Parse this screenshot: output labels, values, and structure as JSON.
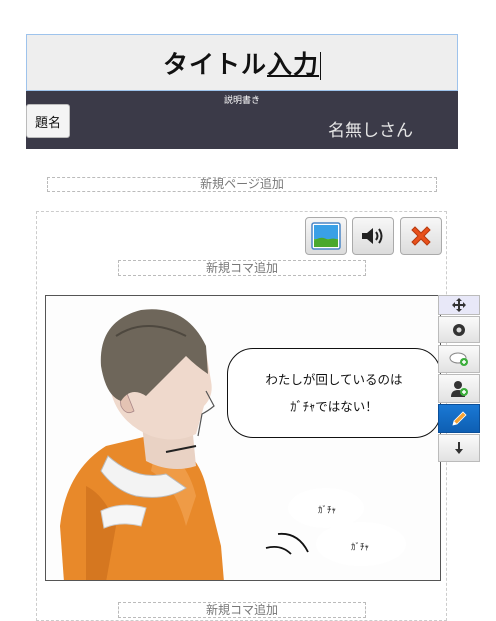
{
  "title": {
    "text_plain": "タイトル",
    "text_composing": "入力"
  },
  "header": {
    "description_label": "説明書き",
    "subject_button": "題名",
    "author_name": "名無しさん"
  },
  "add_page_label": "新規ページ追加",
  "add_panel_label": "新規コマ追加",
  "page_toolbar": {
    "image_icon": "image-icon",
    "sound_icon": "speaker-icon",
    "delete_icon": "close-icon"
  },
  "panel": {
    "speech_line1": "わたしが回しているのは",
    "speech_line2": "ｶﾞﾁｬではない！",
    "sfx1": "ｶﾞﾁｬ",
    "sfx2": "ｶﾞﾁｬ"
  },
  "tools": [
    "move-icon",
    "record-icon",
    "add-bubble-icon",
    "add-character-icon",
    "pencil-icon",
    "down-arrow-icon"
  ]
}
